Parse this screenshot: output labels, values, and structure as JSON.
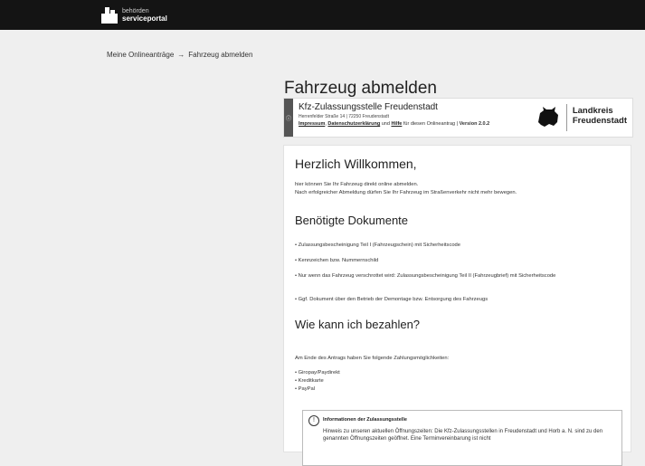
{
  "header": {
    "logo_line1": "behörden",
    "logo_line2": "serviceportal"
  },
  "breadcrumb": {
    "item1": "Meine Onlineanträge",
    "separator": "→",
    "item2": "Fahrzeug abmelden"
  },
  "page": {
    "title": "Fahrzeug abmelden"
  },
  "office": {
    "strip_icon": "info-icon",
    "name": "Kfz-Zulassungsstelle Freudenstadt",
    "address": "Herrenfelder Straße 14 | 72250 Freudenstadt",
    "link_impressum": "Impressum",
    "link_datenschutz": "Datenschutzerklärung",
    "and_text": "und",
    "link_hilfe": "Hilfe",
    "help_suffix": "für diesen Onlineantrag |",
    "version": "Version 2.0.2",
    "district_line1": "Landkreis",
    "district_line2": "Freudenstadt"
  },
  "content": {
    "welcome_title": "Herzlich Willkommen,",
    "welcome_p1": "hier können Sie Ihr Fahrzeug direkt online abmelden.",
    "welcome_p2": "Nach erfolgreicher Abmeldung dürfen Sie Ihr Fahrzeug im Straßenverkehr nicht mehr bewegen.",
    "docs_title": "Benötigte Dokumente",
    "docs": [
      "• Zulassungsbescheinigung Teil I (Fahrzeugschein) mit Sicherheitscode",
      "• Kennzeichen bzw. Nummernschild",
      "• Nur wenn das Fahrzeug verschrottet wird: Zulassungsbescheinigung Teil II (Fahrzeugbrief) mit Sicherheitscode",
      "• Ggf. Dokument über den Betrieb der Demontage bzw. Entsorgung des Fahrzeugs"
    ],
    "pay_title": "Wie kann ich bezahlen?",
    "pay_intro": "Am Ende des Antrags haben Sie folgende Zahlungsmöglichkeiten:",
    "pay_options": [
      "• Giropay/Paydirekt",
      "• Kreditkarte",
      "• PayPal"
    ],
    "info_title": "Informationen der Zulassungsstelle",
    "info_text": "Hinweis zu unseren aktuellen Öffnungszeiten: Die Kfz-Zulassungsstellen in Freudenstadt und Horb a. N. sind zu den genannten Öffnungszeiten geöffnet. Eine Terminvereinbarung ist nicht"
  }
}
